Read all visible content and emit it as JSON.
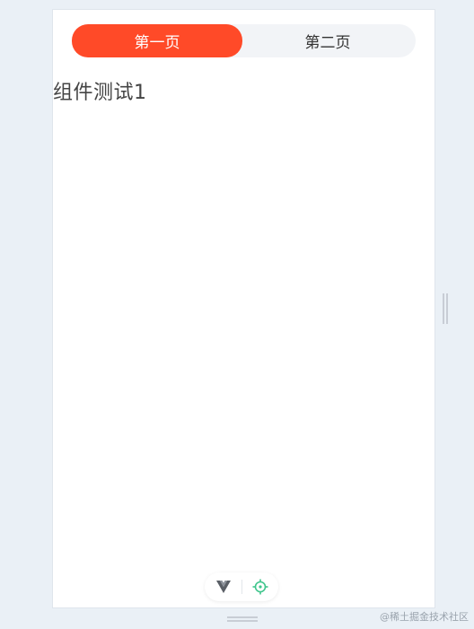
{
  "tabs": [
    {
      "label": "第一页",
      "active": true
    },
    {
      "label": "第二页",
      "active": false
    }
  ],
  "content": {
    "title": "组件测试1"
  },
  "toolbar": {
    "icons": [
      "vue-logo-icon",
      "locate-icon"
    ]
  },
  "colors": {
    "accent": "#ff4a28",
    "locate": "#3fc58c"
  },
  "watermark": "@稀土掘金技术社区"
}
